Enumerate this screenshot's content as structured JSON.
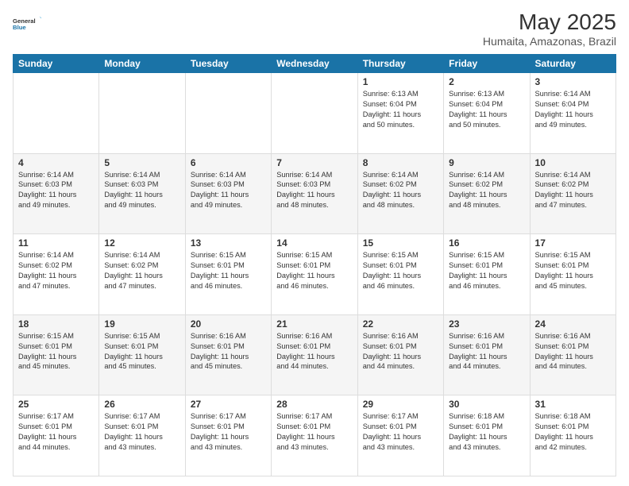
{
  "header": {
    "logo_line1": "General",
    "logo_line2": "Blue",
    "title": "May 2025",
    "subtitle": "Humaita, Amazonas, Brazil"
  },
  "weekdays": [
    "Sunday",
    "Monday",
    "Tuesday",
    "Wednesday",
    "Thursday",
    "Friday",
    "Saturday"
  ],
  "weeks": [
    [
      {
        "day": "",
        "info": ""
      },
      {
        "day": "",
        "info": ""
      },
      {
        "day": "",
        "info": ""
      },
      {
        "day": "",
        "info": ""
      },
      {
        "day": "1",
        "info": "Sunrise: 6:13 AM\nSunset: 6:04 PM\nDaylight: 11 hours\nand 50 minutes."
      },
      {
        "day": "2",
        "info": "Sunrise: 6:13 AM\nSunset: 6:04 PM\nDaylight: 11 hours\nand 50 minutes."
      },
      {
        "day": "3",
        "info": "Sunrise: 6:14 AM\nSunset: 6:04 PM\nDaylight: 11 hours\nand 49 minutes."
      }
    ],
    [
      {
        "day": "4",
        "info": "Sunrise: 6:14 AM\nSunset: 6:03 PM\nDaylight: 11 hours\nand 49 minutes."
      },
      {
        "day": "5",
        "info": "Sunrise: 6:14 AM\nSunset: 6:03 PM\nDaylight: 11 hours\nand 49 minutes."
      },
      {
        "day": "6",
        "info": "Sunrise: 6:14 AM\nSunset: 6:03 PM\nDaylight: 11 hours\nand 49 minutes."
      },
      {
        "day": "7",
        "info": "Sunrise: 6:14 AM\nSunset: 6:03 PM\nDaylight: 11 hours\nand 48 minutes."
      },
      {
        "day": "8",
        "info": "Sunrise: 6:14 AM\nSunset: 6:02 PM\nDaylight: 11 hours\nand 48 minutes."
      },
      {
        "day": "9",
        "info": "Sunrise: 6:14 AM\nSunset: 6:02 PM\nDaylight: 11 hours\nand 48 minutes."
      },
      {
        "day": "10",
        "info": "Sunrise: 6:14 AM\nSunset: 6:02 PM\nDaylight: 11 hours\nand 47 minutes."
      }
    ],
    [
      {
        "day": "11",
        "info": "Sunrise: 6:14 AM\nSunset: 6:02 PM\nDaylight: 11 hours\nand 47 minutes."
      },
      {
        "day": "12",
        "info": "Sunrise: 6:14 AM\nSunset: 6:02 PM\nDaylight: 11 hours\nand 47 minutes."
      },
      {
        "day": "13",
        "info": "Sunrise: 6:15 AM\nSunset: 6:01 PM\nDaylight: 11 hours\nand 46 minutes."
      },
      {
        "day": "14",
        "info": "Sunrise: 6:15 AM\nSunset: 6:01 PM\nDaylight: 11 hours\nand 46 minutes."
      },
      {
        "day": "15",
        "info": "Sunrise: 6:15 AM\nSunset: 6:01 PM\nDaylight: 11 hours\nand 46 minutes."
      },
      {
        "day": "16",
        "info": "Sunrise: 6:15 AM\nSunset: 6:01 PM\nDaylight: 11 hours\nand 46 minutes."
      },
      {
        "day": "17",
        "info": "Sunrise: 6:15 AM\nSunset: 6:01 PM\nDaylight: 11 hours\nand 45 minutes."
      }
    ],
    [
      {
        "day": "18",
        "info": "Sunrise: 6:15 AM\nSunset: 6:01 PM\nDaylight: 11 hours\nand 45 minutes."
      },
      {
        "day": "19",
        "info": "Sunrise: 6:15 AM\nSunset: 6:01 PM\nDaylight: 11 hours\nand 45 minutes."
      },
      {
        "day": "20",
        "info": "Sunrise: 6:16 AM\nSunset: 6:01 PM\nDaylight: 11 hours\nand 45 minutes."
      },
      {
        "day": "21",
        "info": "Sunrise: 6:16 AM\nSunset: 6:01 PM\nDaylight: 11 hours\nand 44 minutes."
      },
      {
        "day": "22",
        "info": "Sunrise: 6:16 AM\nSunset: 6:01 PM\nDaylight: 11 hours\nand 44 minutes."
      },
      {
        "day": "23",
        "info": "Sunrise: 6:16 AM\nSunset: 6:01 PM\nDaylight: 11 hours\nand 44 minutes."
      },
      {
        "day": "24",
        "info": "Sunrise: 6:16 AM\nSunset: 6:01 PM\nDaylight: 11 hours\nand 44 minutes."
      }
    ],
    [
      {
        "day": "25",
        "info": "Sunrise: 6:17 AM\nSunset: 6:01 PM\nDaylight: 11 hours\nand 44 minutes."
      },
      {
        "day": "26",
        "info": "Sunrise: 6:17 AM\nSunset: 6:01 PM\nDaylight: 11 hours\nand 43 minutes."
      },
      {
        "day": "27",
        "info": "Sunrise: 6:17 AM\nSunset: 6:01 PM\nDaylight: 11 hours\nand 43 minutes."
      },
      {
        "day": "28",
        "info": "Sunrise: 6:17 AM\nSunset: 6:01 PM\nDaylight: 11 hours\nand 43 minutes."
      },
      {
        "day": "29",
        "info": "Sunrise: 6:17 AM\nSunset: 6:01 PM\nDaylight: 11 hours\nand 43 minutes."
      },
      {
        "day": "30",
        "info": "Sunrise: 6:18 AM\nSunset: 6:01 PM\nDaylight: 11 hours\nand 43 minutes."
      },
      {
        "day": "31",
        "info": "Sunrise: 6:18 AM\nSunset: 6:01 PM\nDaylight: 11 hours\nand 42 minutes."
      }
    ]
  ]
}
